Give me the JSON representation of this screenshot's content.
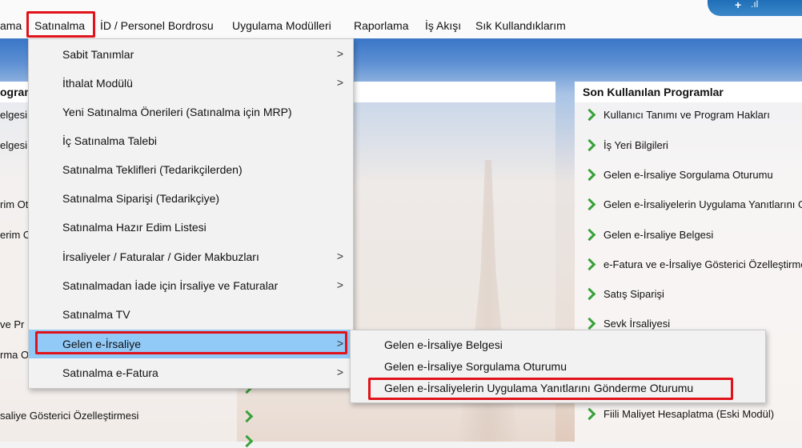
{
  "menubar": {
    "items": [
      "ama",
      "Satınalma",
      "İD / Personel Bordrosu",
      "Uygulama Modülleri",
      "Raporlama",
      "İş Akışı",
      "Sık Kullandıklarım"
    ]
  },
  "left_panel": {
    "title": "ogram",
    "rows": [
      "elgesi",
      "elgesi",
      "rim Ot",
      "erim Ot",
      "ve Pr",
      "rma O",
      "saliye Gösterici Özelleştirmesi"
    ]
  },
  "recent_programs": {
    "title": "Son Kullanılan Programlar",
    "items": [
      "Kullanıcı Tanımı ve Program Hakları",
      "İş Yeri Bilgileri",
      "Gelen e-İrsaliye Sorgulama Oturumu",
      "Gelen e-İrsaliyelerin Uygulama Yanıtlarını G",
      "Gelen e-İrsaliye Belgesi",
      "e-Fatura ve e-İrsaliye Gösterici Özelleştirme",
      "Satış Siparişi",
      "Sevk İrsaliyesi",
      "Fiili Maliyet Hesaplatma (Eski Modül)"
    ]
  },
  "dropdown": {
    "items": [
      {
        "label": "Sabit Tanımlar",
        "submenu": true
      },
      {
        "label": "İthalat Modülü",
        "submenu": true
      },
      {
        "label": "Yeni Satınalma Önerileri (Satınalma için MRP)",
        "submenu": false
      },
      {
        "label": "İç Satınalma Talebi",
        "submenu": false
      },
      {
        "label": "Satınalma Teklifleri (Tedarikçilerden)",
        "submenu": false
      },
      {
        "label": "Satınalma Siparişi (Tedarikçiye)",
        "submenu": false
      },
      {
        "label": "Satınalma Hazır Edim Listesi",
        "submenu": false
      },
      {
        "label": "İrsaliyeler / Faturalar / Gider Makbuzları",
        "submenu": true
      },
      {
        "label": "Satınalmadan İade için İrsaliye ve Faturalar",
        "submenu": true
      },
      {
        "label": "Satınalma TV",
        "submenu": false
      },
      {
        "label": "Gelen e-İrsaliye",
        "submenu": true
      },
      {
        "label": "Satınalma e-Fatura",
        "submenu": true
      }
    ],
    "arrow_glyph": ">"
  },
  "submenu": {
    "items": [
      "Gelen e-İrsaliye Belgesi",
      "Gelen e-İrsaliye Sorgulama Oturumu",
      "Gelen e-İrsaliyelerin Uygulama Yanıtlarını Gönderme Oturumu"
    ]
  },
  "colors": {
    "highlight": "#91c9f7",
    "annotation_red": "#e0131b",
    "chevron_green": "#39a13a"
  }
}
